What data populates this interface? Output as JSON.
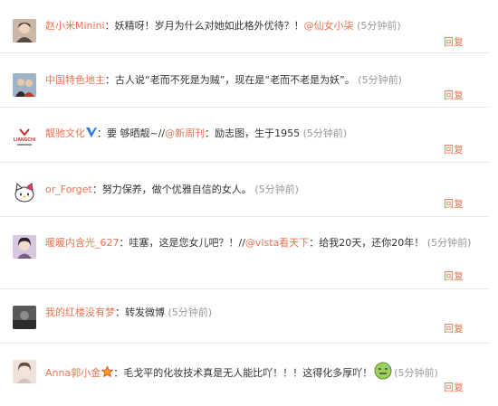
{
  "colors": {
    "link": "#eb7350",
    "text": "#333333",
    "time": "#999999",
    "divider": "#e8e8e8"
  },
  "comments": [
    {
      "user": "赵小米Minini",
      "sep": "：",
      "text1": "妖精呀！岁月为什么对她如此格外优待？！",
      "mention": "@仙女小柒",
      "text2": "",
      "time": "(5分钟前)",
      "reply": "回复",
      "avatar": "woman-avatar-icon"
    },
    {
      "user": "中国特色地主",
      "sep": "：",
      "text1": "古人说“老而不死是为贼”，现在是“老而不老是为妖”。",
      "mention": "",
      "text2": "",
      "time": "(5分钟前)",
      "reply": "回复",
      "avatar": "couple-avatar-icon"
    },
    {
      "user": "靓驰文化",
      "badge": "verified-v-icon",
      "sep": "：",
      "text1": "要 够晒靓~//",
      "mention": "@新周刊",
      "text2": "：励志图，生于1955",
      "time": "(5分钟前)",
      "reply": "回复",
      "avatar": "liangchi-logo-icon",
      "logo_text": "LIANGCHI"
    },
    {
      "user": "or_Forget",
      "sep": "：",
      "text1": "努力保养，做个优雅自信的女人。",
      "mention": "",
      "text2": "",
      "time": "(5分钟前)",
      "reply": "回复",
      "avatar": "hello-kitty-avatar-icon"
    },
    {
      "user": "暖暖内含光_627",
      "sep": "：",
      "text1": "哇塞，这是您女儿吧？！//",
      "mention": "@vista看天下",
      "text2": "：给我20天，还你20年！",
      "time": "(5分钟前)",
      "reply": "回复",
      "avatar": "woman-avatar-icon"
    },
    {
      "user": "我的红楼没有梦",
      "sep": "：",
      "text1": "转发微博",
      "mention": "",
      "text2": "",
      "time": "(5分钟前)",
      "reply": "回复",
      "avatar": "dark-photo-avatar-icon"
    },
    {
      "user": "Anna郭小金",
      "badge": "star-badge-icon",
      "sep": "：",
      "text1": "毛戈平的化妆技术真是无人能比吖！！！这得化多厚吖！",
      "mention": "",
      "text2": "",
      "emoji": "sweat-face-emoji-icon",
      "time": "(5分钟前)",
      "reply": "回复",
      "avatar": "woman-avatar-icon"
    }
  ]
}
